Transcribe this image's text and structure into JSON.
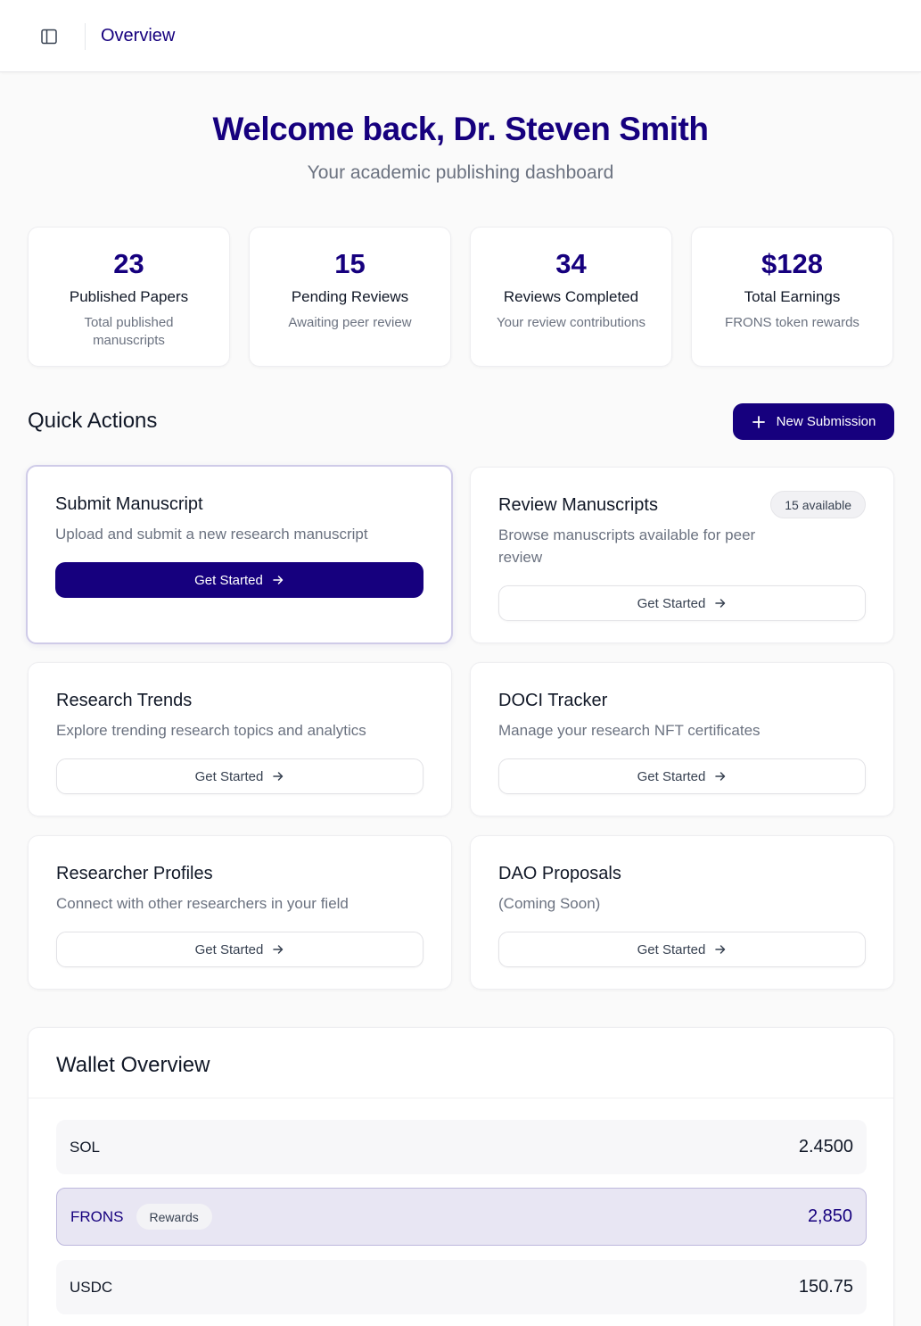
{
  "header": {
    "title": "Overview",
    "sidebar_toggle_icon": "sidebar-panel-icon"
  },
  "welcome": {
    "title": "Welcome back, Dr. Steven Smith",
    "subtitle": "Your academic publishing dashboard"
  },
  "stats": [
    {
      "value": "23",
      "label": "Published Papers",
      "desc": "Total published manuscripts"
    },
    {
      "value": "15",
      "label": "Pending Reviews",
      "desc": "Awaiting peer review"
    },
    {
      "value": "34",
      "label": "Reviews Completed",
      "desc": "Your review contributions"
    },
    {
      "value": "$128",
      "label": "Total Earnings",
      "desc": "FRONS token rewards"
    }
  ],
  "quick_actions": {
    "title": "Quick Actions",
    "new_submission_label": "New Submission",
    "cards": [
      {
        "title": "Submit Manuscript",
        "desc": "Upload and submit a new research manuscript",
        "button": "Get Started"
      },
      {
        "title": "Review Manuscripts",
        "desc": "Browse manuscripts available for peer review",
        "button": "Get Started",
        "badge": "15 available"
      },
      {
        "title": "Research Trends",
        "desc": "Explore trending research topics and analytics",
        "button": "Get Started"
      },
      {
        "title": "DOCI Tracker",
        "desc": "Manage your research NFT certificates",
        "button": "Get Started"
      },
      {
        "title": "Researcher Profiles",
        "desc": "Connect with other researchers in your field",
        "button": "Get Started"
      },
      {
        "title": "DAO Proposals",
        "desc": "(Coming Soon)",
        "button": "Get Started"
      }
    ]
  },
  "wallet": {
    "title": "Wallet Overview",
    "rows": [
      {
        "token": "SOL",
        "amount": "2.4500"
      },
      {
        "token": "FRONS",
        "badge": "Rewards",
        "amount": "2,850"
      },
      {
        "token": "USDC",
        "amount": "150.75"
      }
    ]
  },
  "colors": {
    "brand": "#16007e",
    "muted_text": "#6b7280",
    "highlight_bg": "#e8e6f3"
  }
}
